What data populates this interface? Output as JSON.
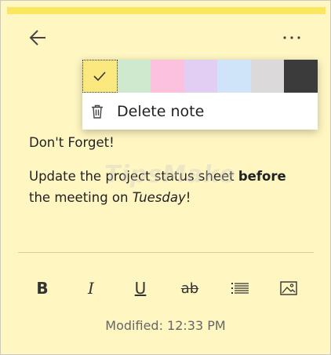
{
  "colors": {
    "note_bg": "#fff6c2",
    "top_bar": "#fbe65f"
  },
  "header": {
    "back_icon": "arrow-left-icon",
    "more_icon": "more-horizontal-icon"
  },
  "color_menu": {
    "swatches": [
      {
        "name": "yellow",
        "color": "#fbe87f",
        "selected": true
      },
      {
        "name": "green",
        "color": "#cfe9ce"
      },
      {
        "name": "pink",
        "color": "#fcc1dc"
      },
      {
        "name": "purple",
        "color": "#e2cdf3"
      },
      {
        "name": "blue",
        "color": "#cfe4f9"
      },
      {
        "name": "gray",
        "color": "#dbd9d9"
      },
      {
        "name": "charcoal",
        "color": "#3b3b3b"
      }
    ],
    "delete_label": "Delete note"
  },
  "note": {
    "line1": "Don't Forget!",
    "line2_part1": "Update the project status sheet ",
    "line2_bold": "before",
    "line3_part1": "the meeting on ",
    "line3_italic": "Tuesday",
    "line3_part2": "!"
  },
  "watermark": "TipsMake",
  "toolbar": {
    "bold": "B",
    "italic": "I",
    "underline": "U",
    "strike": "ab"
  },
  "footer": {
    "modified": "Modified: 12:33 PM"
  }
}
